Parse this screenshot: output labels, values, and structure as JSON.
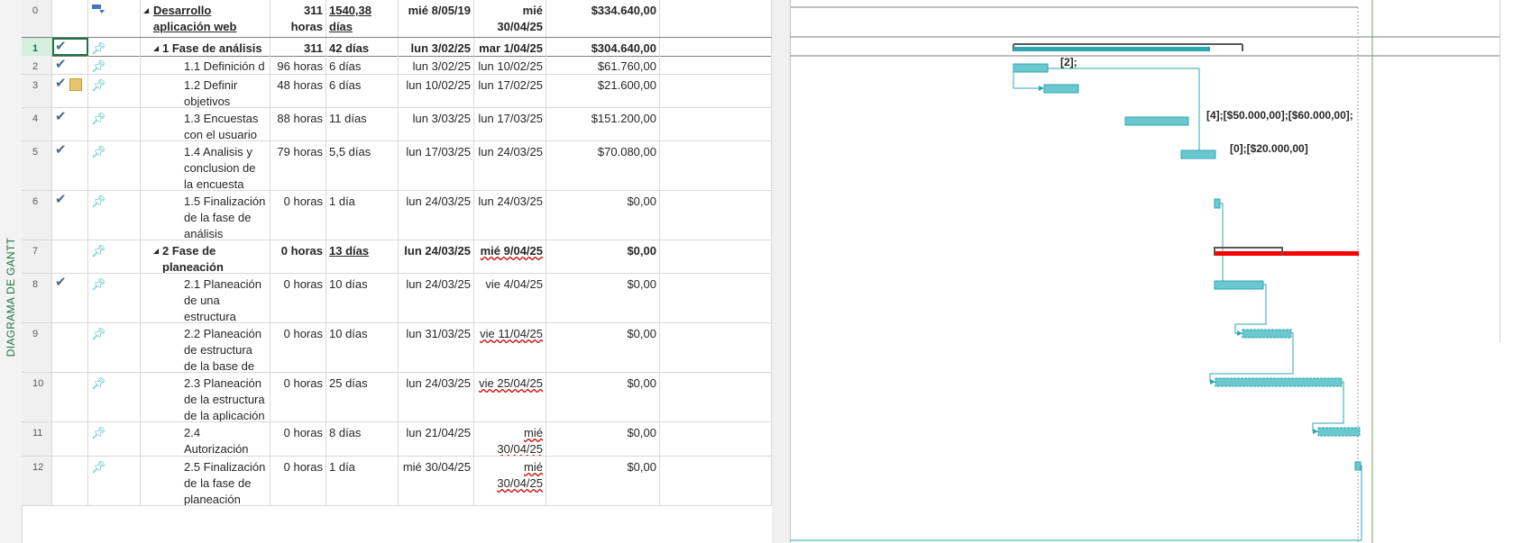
{
  "side_label": "DIAGRAMA DE GANTT",
  "colors": {
    "accent": "#217346",
    "bar": "#3fb7c0",
    "critical": "#ff0000",
    "summary": "#595959",
    "link": "#2ca7b0"
  },
  "rows": [
    {
      "id": "0",
      "name": "Desarrollo aplicación web",
      "work": "311 horas",
      "duration": "1540,38 días",
      "start": "mié 8/05/19",
      "end": "mié 30/04/25",
      "cost": "$334.640,00"
    },
    {
      "id": "1",
      "name": "1 Fase de análisis",
      "work": "311 horas",
      "duration": "42 días",
      "start": "lun 3/02/25",
      "end": "mar 1/04/25",
      "cost": "$304.640,00"
    },
    {
      "id": "2",
      "name": "1.1 Definición d",
      "work": "96 horas",
      "duration": "6 días",
      "start": "lun 3/02/25",
      "end": "lun 10/02/25",
      "cost": "$61.760,00"
    },
    {
      "id": "3",
      "name": "1.2 Definir objetivos",
      "work": "48 horas",
      "duration": "6 días",
      "start": "lun 10/02/25",
      "end": "lun 17/02/25",
      "cost": "$21.600,00"
    },
    {
      "id": "4",
      "name": "1.3 Encuestas con el usuario",
      "work": "88 horas",
      "duration": "11 días",
      "start": "lun 3/03/25",
      "end": "lun 17/03/25",
      "cost": "$151.200,00"
    },
    {
      "id": "5",
      "name": "1.4 Analisis y conclusion de la encuesta",
      "work": "79 horas",
      "duration": "5,5 días",
      "start": "lun 17/03/25",
      "end": "lun 24/03/25",
      "cost": "$70.080,00"
    },
    {
      "id": "6",
      "name": "1.5 Finalización de la fase de análisis",
      "work": "0 horas",
      "duration": "1 día",
      "start": "lun 24/03/25",
      "end": "lun 24/03/25",
      "cost": "$0,00"
    },
    {
      "id": "7",
      "name": "2 Fase de planeación",
      "work": "0 horas",
      "duration": "13 días",
      "start": "lun 24/03/25",
      "end": "mié 9/04/25",
      "cost": "$0,00"
    },
    {
      "id": "8",
      "name": "2.1 Planeación de una estructura",
      "work": "0 horas",
      "duration": "10 días",
      "start": "lun 24/03/25",
      "end": "vie 4/04/25",
      "cost": "$0,00"
    },
    {
      "id": "9",
      "name": "2.2 Planeación de estructura de la base de",
      "work": "0 horas",
      "duration": "10 días",
      "start": "lun 31/03/25",
      "end": "vie 11/04/25",
      "cost": "$0,00"
    },
    {
      "id": "10",
      "name": "2.3 Planeación de la estructura de la aplicación",
      "work": "0 horas",
      "duration": "25 días",
      "start": "lun 24/03/25",
      "end": "vie 25/04/25",
      "cost": "$0,00"
    },
    {
      "id": "11",
      "name": "2.4 Autorización",
      "work": "0 horas",
      "duration": "8 días",
      "start": "lun 21/04/25",
      "end": "mié 30/04/25",
      "cost": "$0,00"
    },
    {
      "id": "12",
      "name": "2.5 Finalización de la fase de planeación",
      "work": "0 horas",
      "duration": "1 día",
      "start": "mié 30/04/25",
      "end": "mié 30/04/25",
      "cost": "$0,00"
    }
  ],
  "gantt_labels": {
    "task2": "[2];",
    "task4": "[4];[$50.000,00];[$60.000,00];",
    "task5": "[0];[$20.000,00]"
  }
}
